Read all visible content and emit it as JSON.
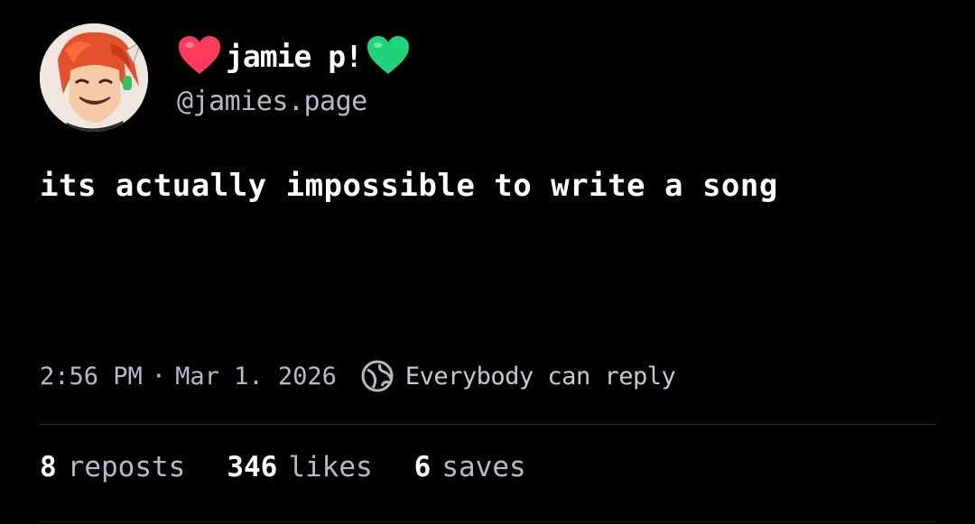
{
  "post": {
    "author": {
      "display_name": "jamie p!",
      "handle": "@jamies.page",
      "name_prefix_emoji": "red-heart",
      "name_suffix_emoji": "green-heart",
      "colors": {
        "red_heart": "#ff3b5c",
        "green_heart": "#1fd37a"
      }
    },
    "text": "its actually impossible to write a song",
    "time": "2:56 PM",
    "separator": "·",
    "date": "Mar 1. 2026",
    "reply_icon": "globe-icon",
    "reply_setting": "Everybody can reply",
    "stats": [
      {
        "count": "8",
        "label": "reposts"
      },
      {
        "count": "346",
        "label": "likes"
      },
      {
        "count": "6",
        "label": "saves"
      }
    ]
  },
  "theme": {
    "background": "#000000",
    "text_primary": "#ffffff",
    "text_secondary": "#b7b9c8",
    "divider": "#2a2e38"
  }
}
